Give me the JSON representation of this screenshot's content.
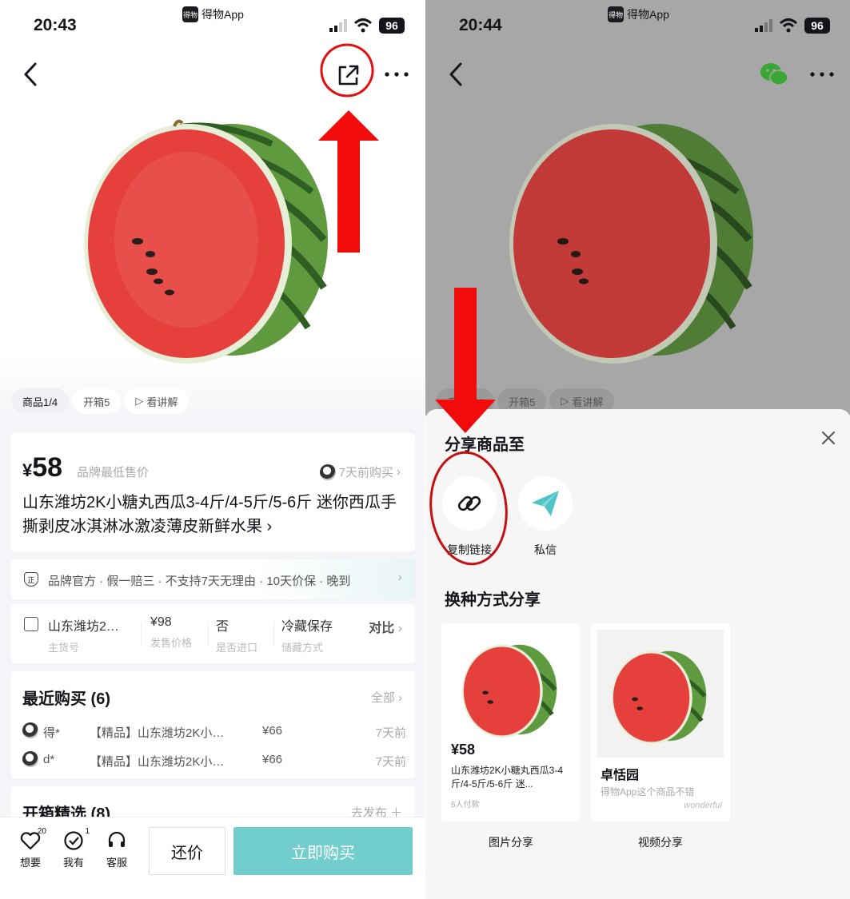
{
  "status": {
    "time_left": "20:43",
    "time_right": "20:44",
    "app_name": "得物App",
    "app_badge": "得物",
    "battery": "96"
  },
  "product": {
    "tabs": [
      "商品1/4",
      "开箱5",
      "看讲解"
    ],
    "price_symbol": "¥",
    "price": "58",
    "price_note": "品牌最低售价",
    "recent_buy": "7天前购买",
    "title": "山东潍坊2K小糖丸西瓜3-4斤/4-5斤/5-6斤 迷你西瓜手撕剥皮冰淇淋冰激凌薄皮新鲜水果",
    "guarantee": "品牌官方 · 假一赔三 · 不支持7天无理由 · 10天价保 · 晚到",
    "specs": [
      {
        "value": "山东潍坊2…",
        "key": "主货号"
      },
      {
        "value": "¥98",
        "key": "发售价格"
      },
      {
        "value": "否",
        "key": "是否进口"
      },
      {
        "value": "冷藏保存",
        "key": "储藏方式"
      }
    ],
    "compare": "对比",
    "recent": {
      "title": "最近购买 (6)",
      "all": "全部",
      "rows": [
        {
          "name": "得*",
          "product": "【精品】山东潍坊2K小…",
          "price": "¥66",
          "time": "7天前"
        },
        {
          "name": "d*",
          "product": "【精品】山东潍坊2K小…",
          "price": "¥66",
          "time": "7天前"
        }
      ]
    },
    "unbox": {
      "title": "开箱精选 (8)",
      "publish": "去发布"
    }
  },
  "bottom": {
    "want": "想要",
    "want_count": "20",
    "have": "我有",
    "have_count": "1",
    "service": "客服",
    "haggle": "还价",
    "buy": "立即购买"
  },
  "share": {
    "title": "分享商品至",
    "copy_link": "复制链接",
    "private_msg": "私信",
    "alt_title": "换种方式分享",
    "image_card": {
      "price": "¥58",
      "title": "山东潍坊2K小糖丸西瓜3-4斤/4-5斤/5-6斤 迷...",
      "paid": "6人付款",
      "label": "图片分享"
    },
    "video_card": {
      "name": "卓恬园",
      "line": "得物App这个商品不错",
      "watermark": "wonderful",
      "label": "视频分享"
    }
  },
  "colors": {
    "buy_button": "#72cdcd",
    "annotation_red": "#e01010",
    "wechat_green": "#3aa635",
    "message_teal": "#4fc3c7"
  }
}
